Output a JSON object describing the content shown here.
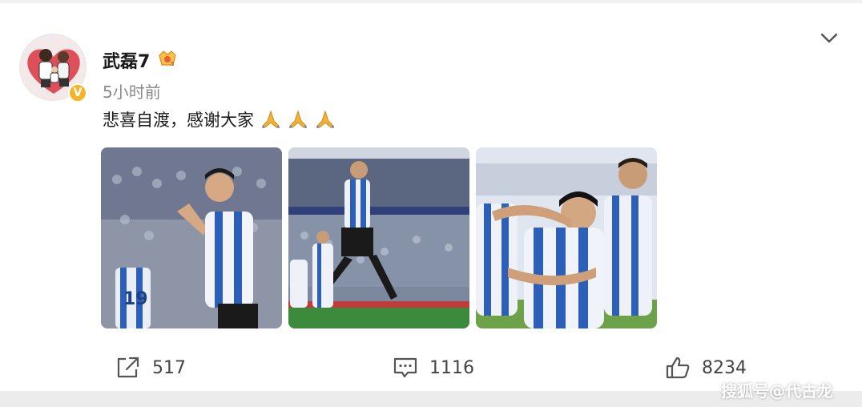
{
  "post": {
    "username": "武磊7",
    "timestamp": "5小时前",
    "text": "悲喜自渡，感谢大家",
    "emoji_count": 3
  },
  "photos": [
    {
      "name": "photo-celebration"
    },
    {
      "name": "photo-jump"
    },
    {
      "name": "photo-team-hug"
    }
  ],
  "actions": {
    "share_count": "517",
    "comment_count": "1116",
    "like_count": "8234"
  },
  "watermark": "搜狐号@代古龙",
  "icons": {
    "verified": "verified-badge-icon",
    "member": "member-badge-icon",
    "menu": "chevron-down-icon",
    "share": "share-icon",
    "comment": "comment-icon",
    "like": "thumbs-up-icon"
  },
  "colors": {
    "verified": "#f5b52a",
    "text": "#1a1a1a",
    "muted": "#8a8a8a"
  }
}
